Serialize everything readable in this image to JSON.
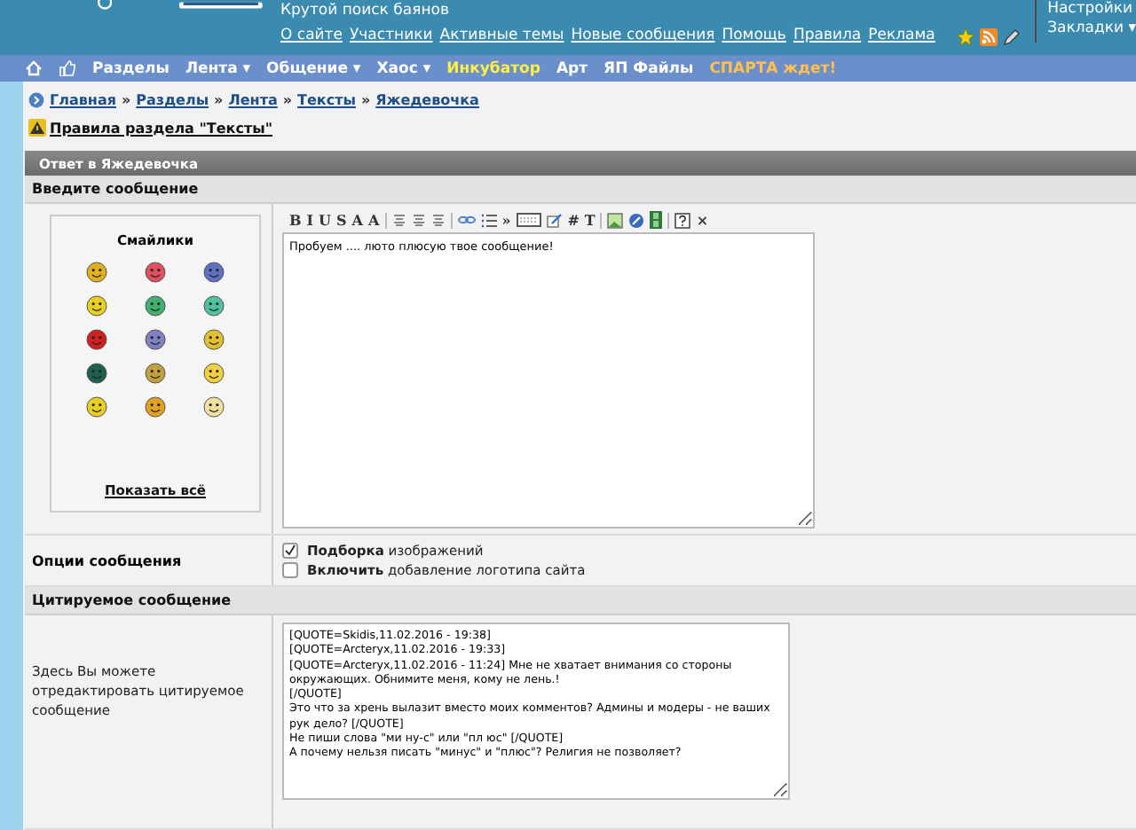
{
  "header": {
    "tagline": "Крутой поиск баянов",
    "links": [
      "О сайте",
      "Участники",
      "Активные темы",
      "Новые сообщения",
      "Помощь",
      "Правила",
      "Реклама"
    ],
    "user_menu": [
      "Настройки",
      "Закладки ▾"
    ]
  },
  "nav": {
    "items": [
      {
        "label": "Разделы",
        "kind": "plain"
      },
      {
        "label": "Лента ▾",
        "kind": "plain"
      },
      {
        "label": "Общение ▾",
        "kind": "plain"
      },
      {
        "label": "Хаос ▾",
        "kind": "plain"
      },
      {
        "label": "Инкубатор",
        "kind": "yellow"
      },
      {
        "label": "Арт",
        "kind": "plain"
      },
      {
        "label": "ЯП Файлы",
        "kind": "plain"
      },
      {
        "label": "СПАРТА ждет!",
        "kind": "orange"
      }
    ]
  },
  "breadcrumb": [
    "Главная",
    "Разделы",
    "Лента",
    "Тексты",
    "Яжедевочка"
  ],
  "breadcrumb_separator": "»",
  "rules_link": "Правила раздела \"Тексты\"",
  "form": {
    "title": "Ответ в Яжедевочка",
    "message_heading": "Введите сообщение",
    "smilies": {
      "title": "Смайлики",
      "show_all": "Показать всё"
    },
    "toolbar": [
      {
        "kind": "glyph",
        "label": "B"
      },
      {
        "kind": "glyph",
        "label": "I"
      },
      {
        "kind": "glyph",
        "label": "U"
      },
      {
        "kind": "glyph",
        "label": "S"
      },
      {
        "kind": "glyph",
        "label": "A"
      },
      {
        "kind": "glyph",
        "label": "A"
      },
      {
        "kind": "sep"
      },
      {
        "kind": "align"
      },
      {
        "kind": "align"
      },
      {
        "kind": "align"
      },
      {
        "kind": "sep"
      },
      {
        "kind": "link"
      },
      {
        "kind": "list"
      },
      {
        "kind": "glyph",
        "label": "»"
      },
      {
        "kind": "keyboard"
      },
      {
        "kind": "pen"
      },
      {
        "kind": "glyph",
        "label": "#"
      },
      {
        "kind": "glyph",
        "label": "T"
      },
      {
        "kind": "sep"
      },
      {
        "kind": "image"
      },
      {
        "kind": "disc"
      },
      {
        "kind": "film"
      },
      {
        "kind": "sep"
      },
      {
        "kind": "help"
      },
      {
        "kind": "glyph",
        "label": "×"
      }
    ],
    "message": "Пробуем .... люто плюсую твое сообщение!",
    "options_label": "Опции сообщения",
    "options": [
      {
        "text": "**Подборка** изображений",
        "checked": true
      },
      {
        "text": "**Включить** добавление логотипа сайта",
        "checked": false
      }
    ],
    "quote_heading": "Цитируемое сообщение",
    "quote_label": "Здесь Вы можете отредактировать цитируемое сообщение",
    "quote": "[QUOTE=Skidis,11.02.2016 - 19:38]\n[QUOTE=Arcteryx,11.02.2016 - 19:33]\n[QUOTE=Arcteryx,11.02.2016 - 11:24] Мне не хватает внимания со стороны окружающих. Обнимите меня, кому не лень.!\n[/QUOTE]\nЭто что за хрень вылазит вместо моих комментов? Админы и модеры - не ваших рук дело? [/QUOTE]\nНе пиши слова \"ми ну-с\" или \"пл юс\" [/QUOTE]\nА почему нельзя писать \"минус\" и \"плюс\"? Религия не позволяет?"
  }
}
